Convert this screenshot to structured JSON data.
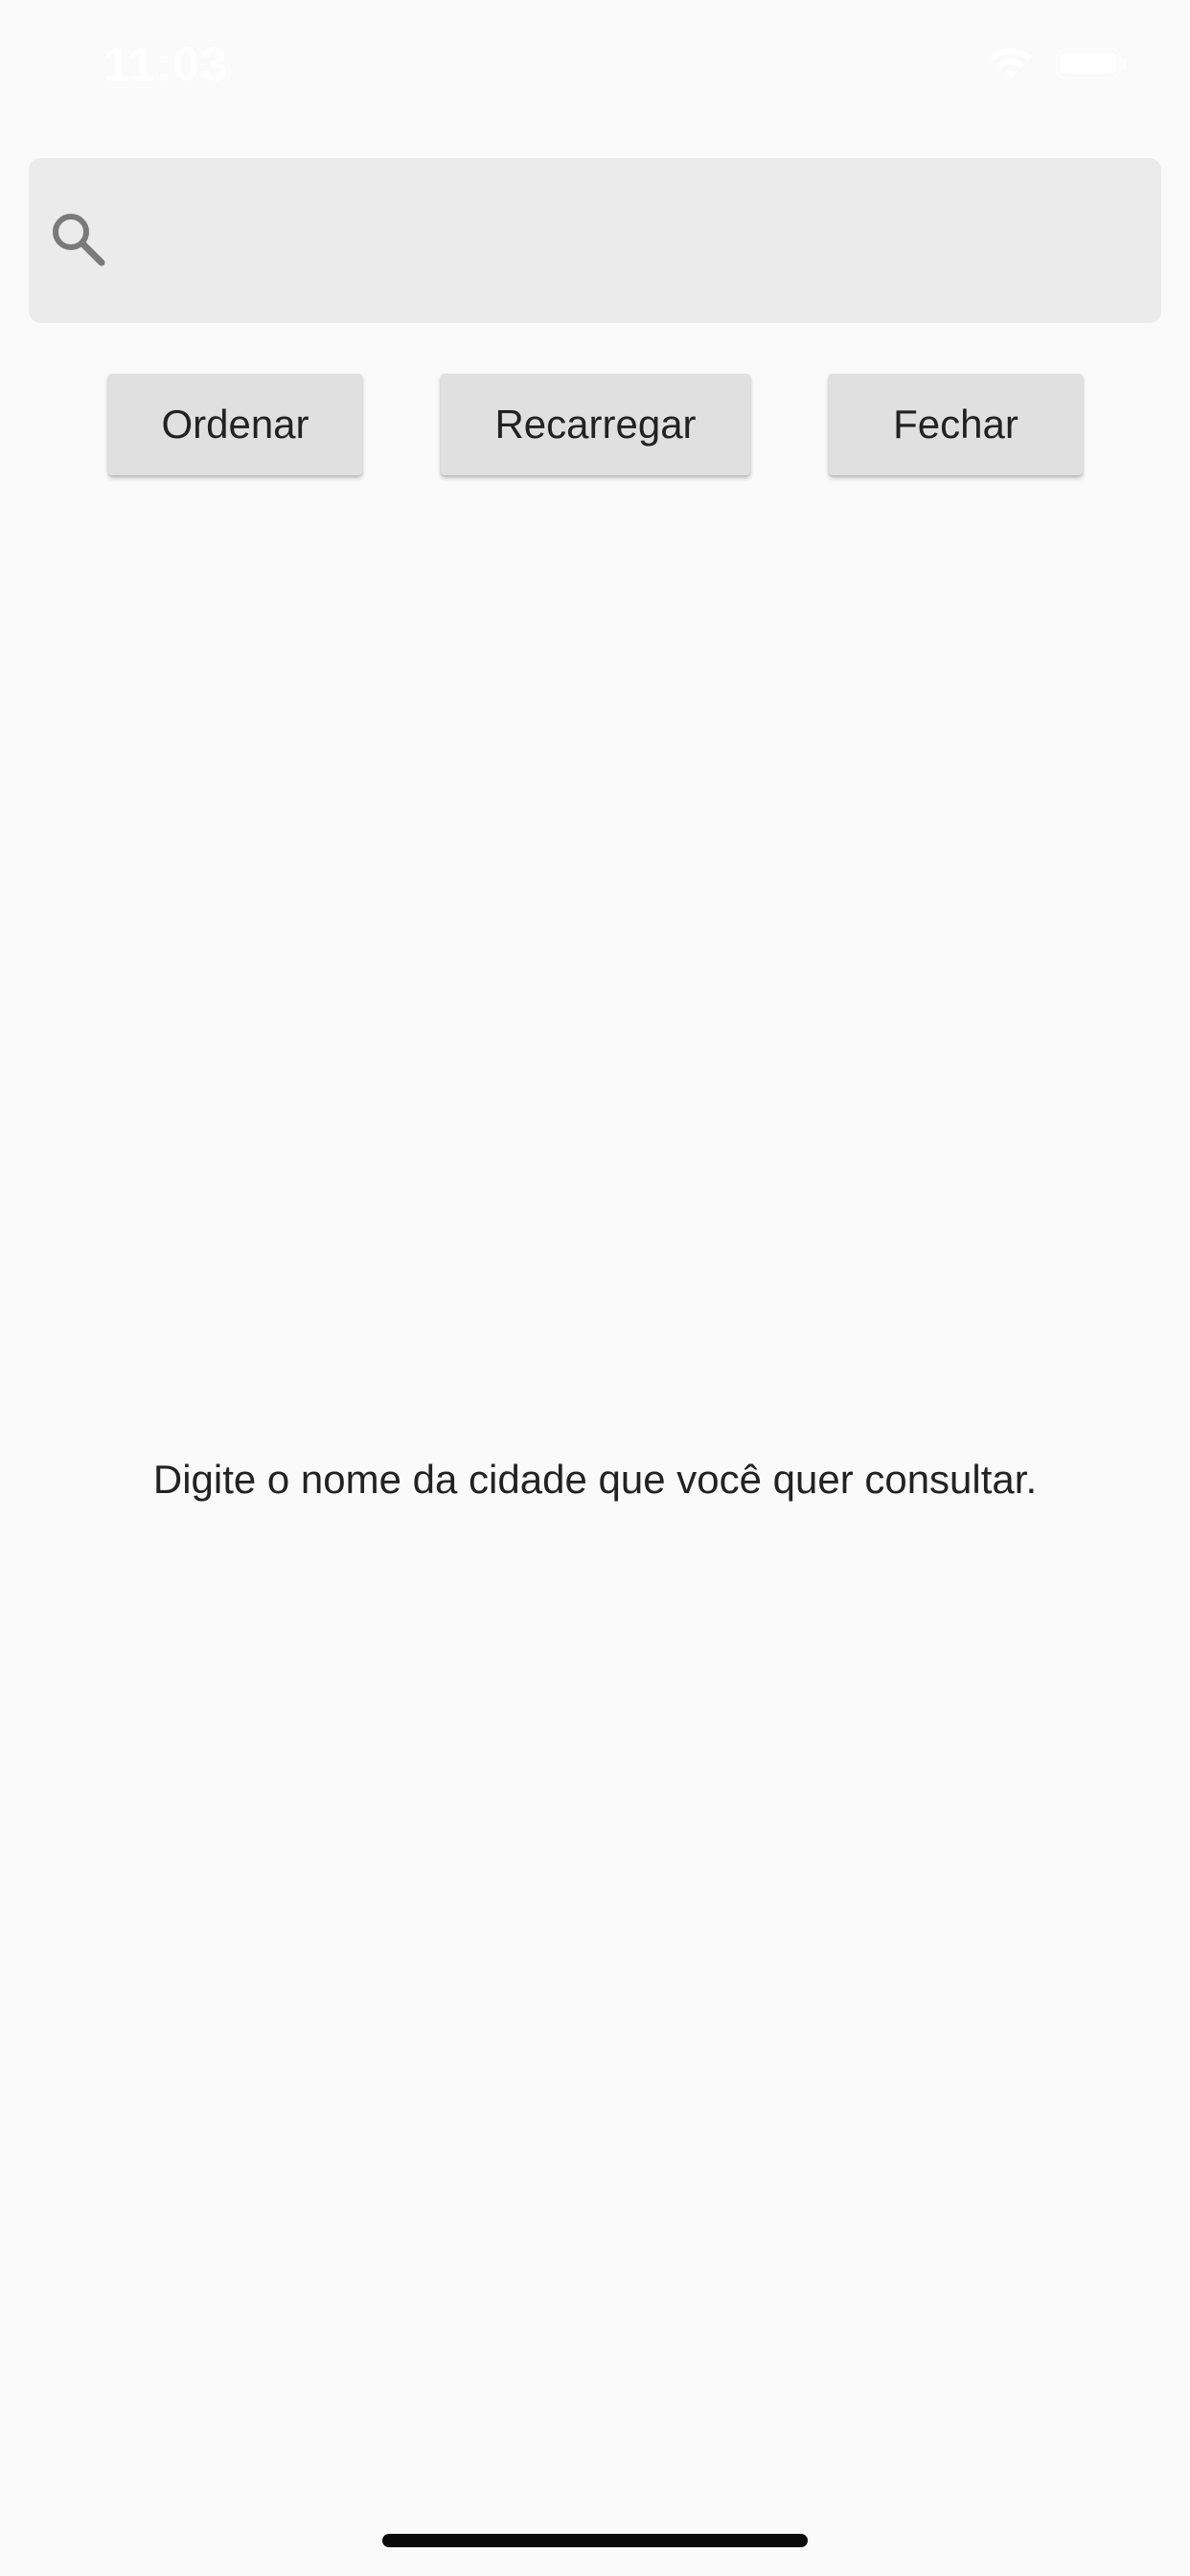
{
  "status_bar": {
    "time": "11:03",
    "wifi_icon": "wifi-icon",
    "battery_icon": "battery-icon",
    "color": "#ffffff"
  },
  "search": {
    "value": "",
    "placeholder": "",
    "icon": "search-icon",
    "background": "#ebebeb"
  },
  "actions": {
    "sort_label": "Ordenar",
    "reload_label": "Recarregar",
    "close_label": "Fechar"
  },
  "main": {
    "empty_message": "Digite o nome da cidade que você quer consultar."
  },
  "theme": {
    "background": "#fafafa",
    "button_background": "#e0e0e0",
    "text_color": "#222222"
  }
}
